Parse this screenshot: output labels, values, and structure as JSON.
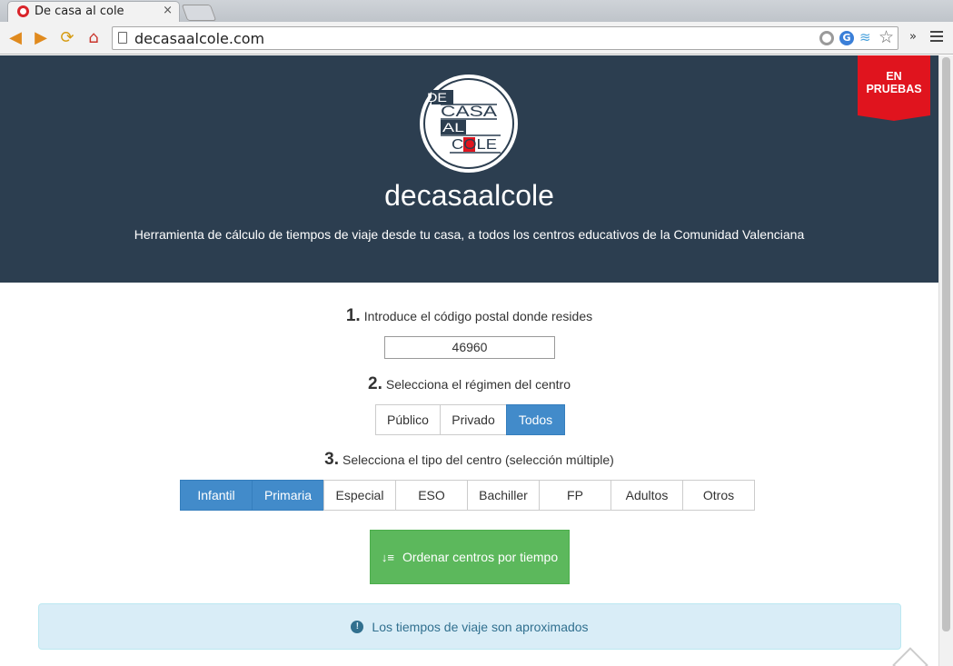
{
  "browser": {
    "tab_title": "De casa al cole",
    "tab_close": "×",
    "url": "decasaalcole.com",
    "more": "»"
  },
  "hero": {
    "ribbon_line1": "EN",
    "ribbon_line2": "PRUEBAS",
    "logo_words": [
      "DE",
      "CASA",
      "AL",
      "COLE"
    ],
    "title": "decasaalcole",
    "subtitle": "Herramienta de cálculo de tiempos de viaje desde tu casa, a todos los centros educativos de la Comunidad Valenciana"
  },
  "step1": {
    "num": "1.",
    "label": "Introduce el código postal donde resides",
    "value": "46960"
  },
  "step2": {
    "num": "2.",
    "label": "Selecciona el régimen del centro",
    "options": [
      {
        "label": "Público",
        "active": false
      },
      {
        "label": "Privado",
        "active": false
      },
      {
        "label": "Todos",
        "active": true
      }
    ]
  },
  "step3": {
    "num": "3.",
    "label": "Selecciona el tipo del centro (selección múltiple)",
    "options": [
      {
        "label": "Infantil",
        "active": true
      },
      {
        "label": "Primaria",
        "active": true
      },
      {
        "label": "Especial",
        "active": false
      },
      {
        "label": "ESO",
        "active": false
      },
      {
        "label": "Bachiller",
        "active": false
      },
      {
        "label": "FP",
        "active": false
      },
      {
        "label": "Adultos",
        "active": false
      },
      {
        "label": "Otros",
        "active": false
      }
    ]
  },
  "sort_button": {
    "label": "Ordenar centros por tiempo",
    "icon": "sort-amount-icon"
  },
  "alert": {
    "text": "Los tiempos de viaje son aproximados",
    "icon": "exclamation-circle-icon"
  },
  "colors": {
    "hero_bg": "#2c3e50",
    "ribbon": "#e0141e",
    "primary": "#428bca",
    "success": "#5cb85c",
    "info_bg": "#d9edf7",
    "info_text": "#31708f"
  }
}
